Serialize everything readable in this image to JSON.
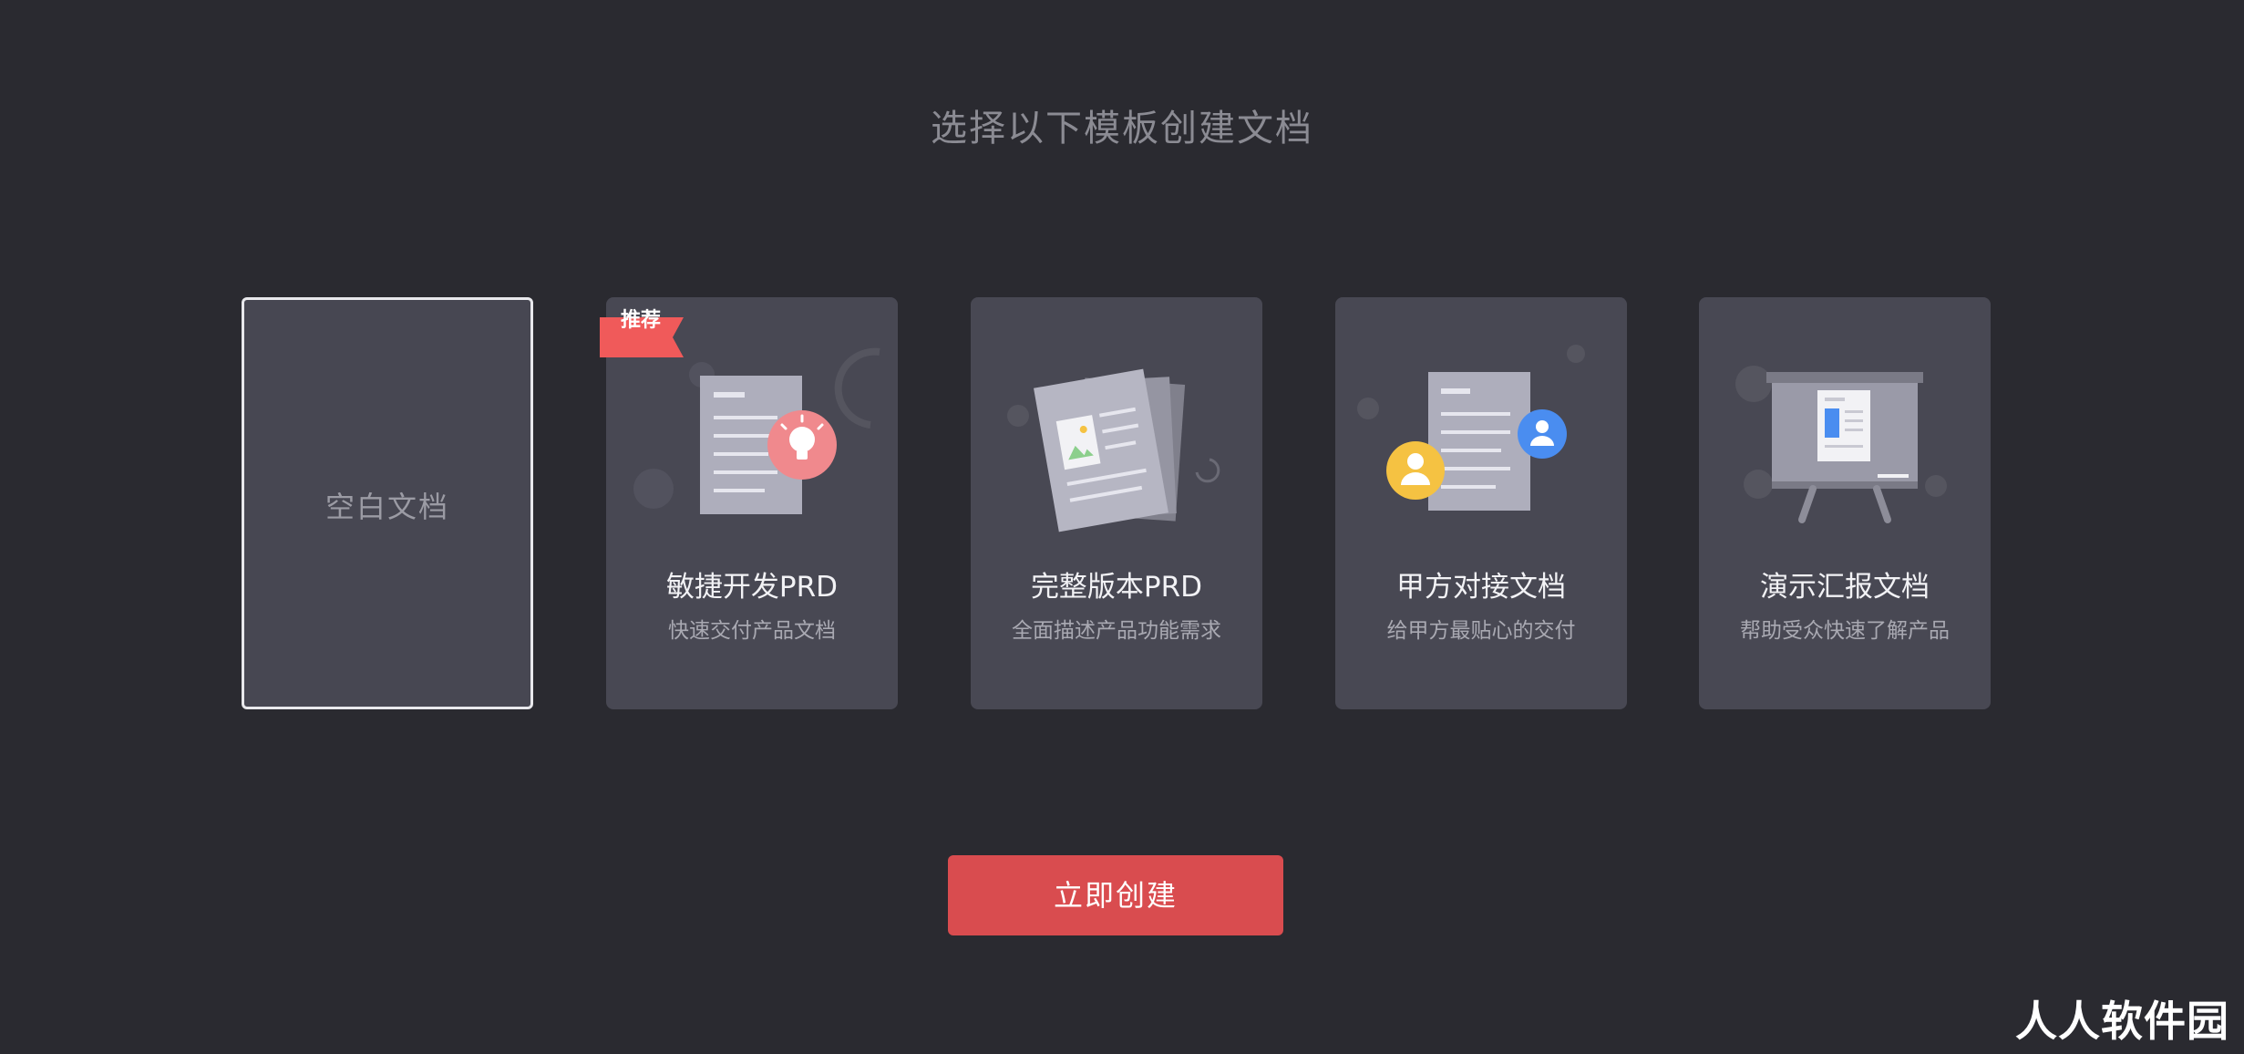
{
  "header": {
    "title": "选择以下模板创建文档"
  },
  "templates": {
    "blank": {
      "label": "空白文档"
    },
    "items": [
      {
        "title": "敏捷开发PRD",
        "description": "快速交付产品文档",
        "badge": "推荐",
        "icon": "document-lightbulb-icon"
      },
      {
        "title": "完整版本PRD",
        "description": "全面描述产品功能需求",
        "icon": "document-stack-image-icon"
      },
      {
        "title": "甲方对接文档",
        "description": "给甲方最贴心的交付",
        "icon": "document-users-icon"
      },
      {
        "title": "演示汇报文档",
        "description": "帮助受众快速了解产品",
        "icon": "presentation-board-icon"
      }
    ]
  },
  "actions": {
    "create_label": "立即创建"
  },
  "watermark": {
    "text": "人人软件园"
  },
  "colors": {
    "background": "#2a2a30",
    "card": "#484853",
    "accent": "#d94c4f",
    "badge": "#f05a5a",
    "user_yellow": "#f5c242",
    "user_blue": "#4a8df0"
  }
}
